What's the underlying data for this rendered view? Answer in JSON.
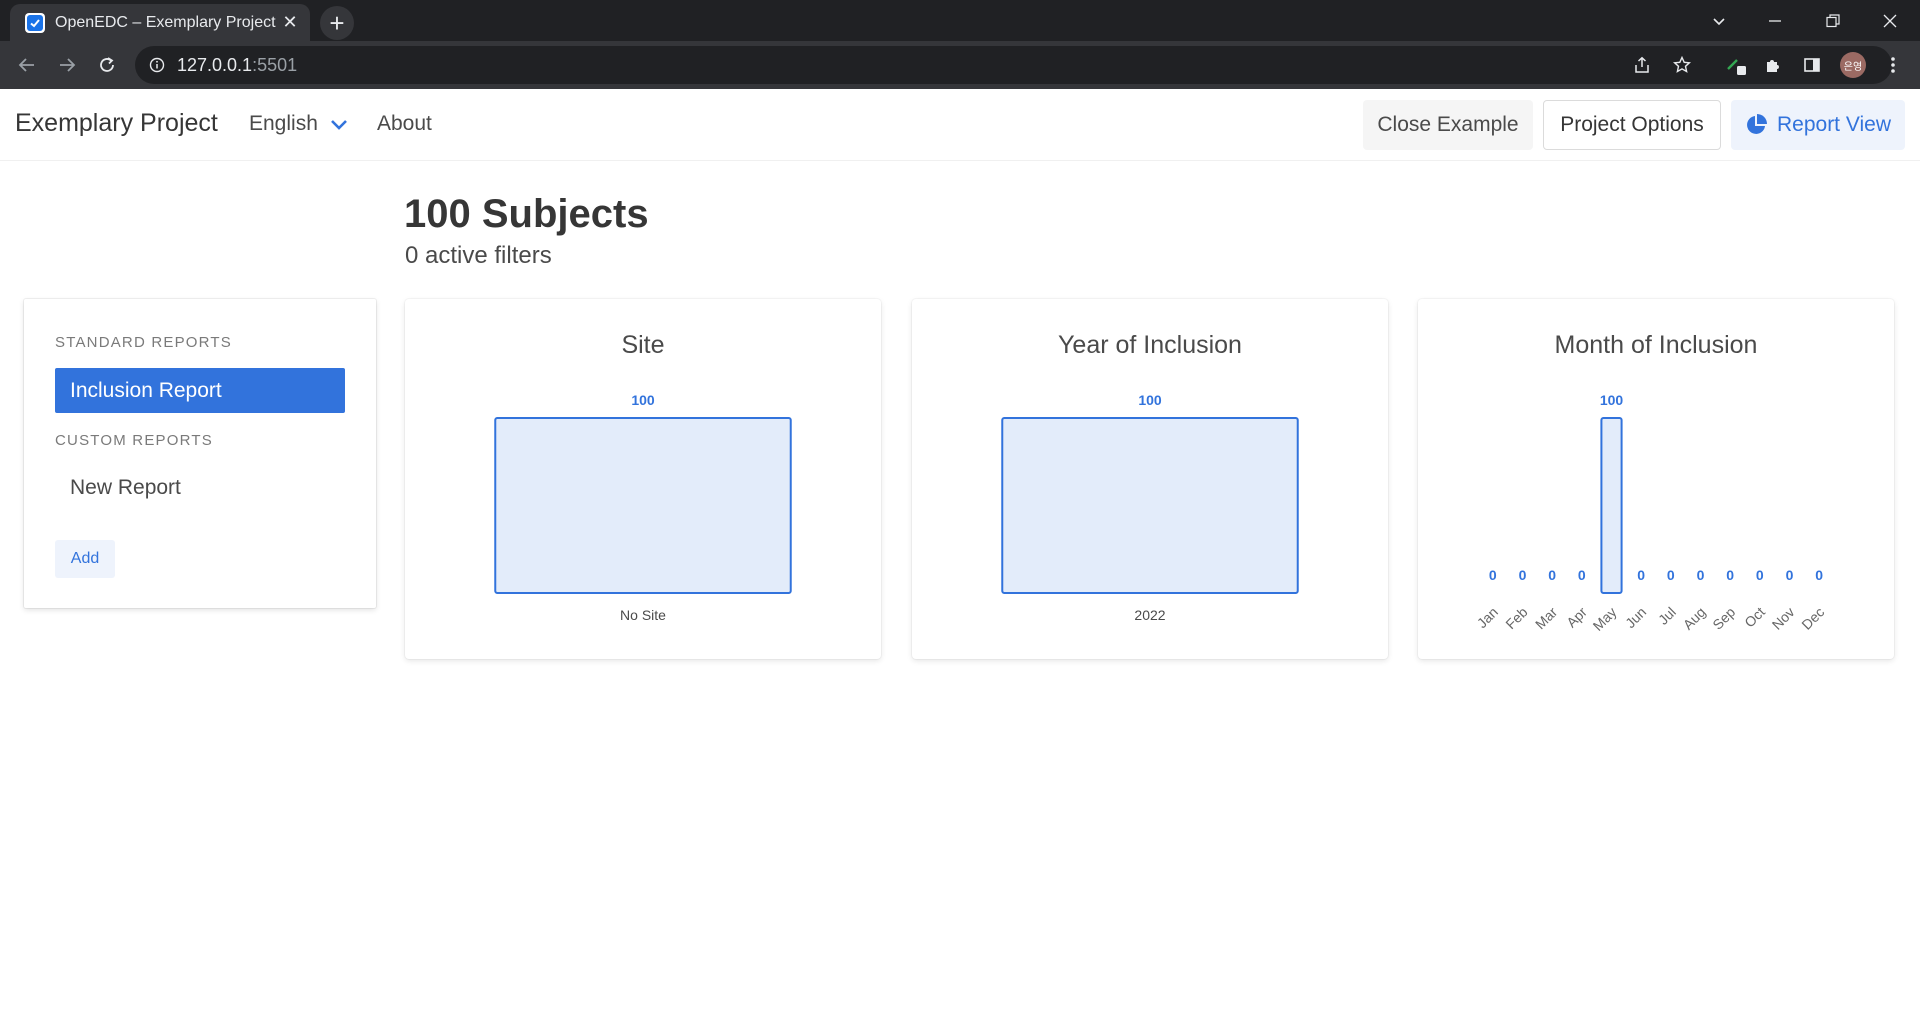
{
  "browser": {
    "tab_title": "OpenEDC – Exemplary Project",
    "url_host": "127.0.0.1",
    "url_port": ":5501",
    "profile_initials": "은영"
  },
  "navbar": {
    "brand": "Exemplary Project",
    "language": "English",
    "about": "About",
    "close_example": "Close Example",
    "project_options": "Project Options",
    "report_view": "Report View"
  },
  "sidebar": {
    "standard_label": "STANDARD REPORTS",
    "standard_items": [
      {
        "label": "Inclusion Report",
        "active": true
      }
    ],
    "custom_label": "CUSTOM REPORTS",
    "custom_items": [
      {
        "label": "New Report",
        "active": false
      }
    ],
    "add_label": "Add"
  },
  "main": {
    "subjects": "100 Subjects",
    "filters": "0 active filters"
  },
  "colors": {
    "accent": "#3273dc",
    "bar_fill": "#e3ecfa"
  },
  "chart_data": [
    {
      "type": "bar",
      "title": "Site",
      "categories": [
        "No Site"
      ],
      "values": [
        100
      ]
    },
    {
      "type": "bar",
      "title": "Year of Inclusion",
      "categories": [
        "2022"
      ],
      "values": [
        100
      ]
    },
    {
      "type": "bar",
      "title": "Month of Inclusion",
      "categories": [
        "Jan",
        "Feb",
        "Mar",
        "Apr",
        "May",
        "Jun",
        "Jul",
        "Aug",
        "Sep",
        "Oct",
        "Nov",
        "Dec"
      ],
      "values": [
        0,
        0,
        0,
        0,
        100,
        0,
        0,
        0,
        0,
        0,
        0,
        0
      ]
    }
  ]
}
